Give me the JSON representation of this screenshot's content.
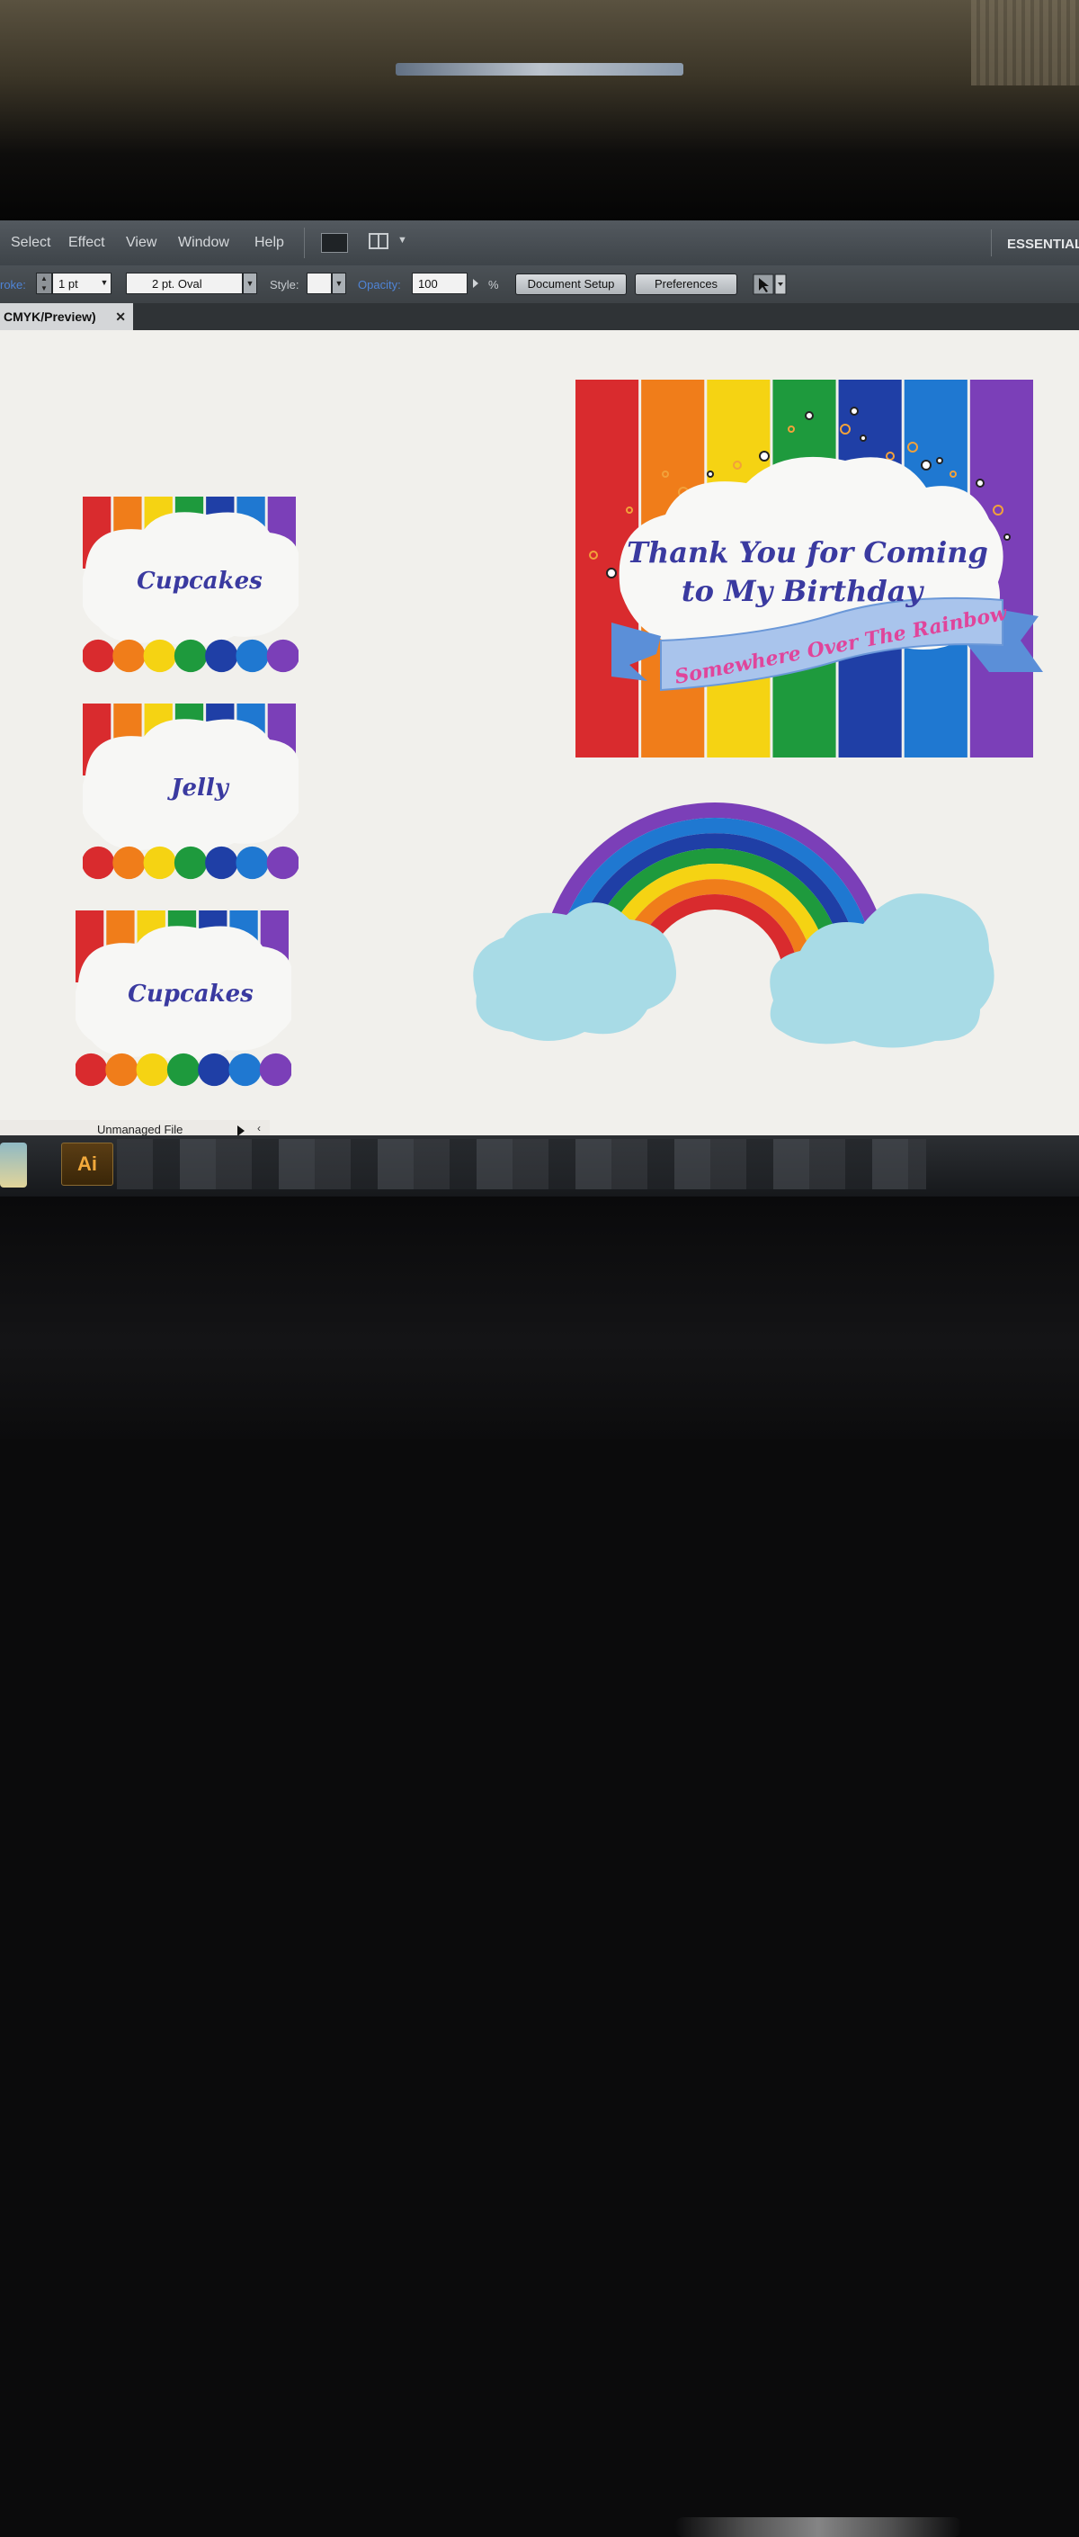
{
  "menubar": {
    "items": [
      "Select",
      "Effect",
      "View",
      "Window",
      "Help"
    ],
    "workspace": "ESSENTIAL"
  },
  "controlbar": {
    "stroke_label": "roke:",
    "stroke_weight": "1 pt",
    "brush": "2 pt. Oval",
    "style_label": "Style:",
    "opacity_label": "Opacity:",
    "opacity_value": "100",
    "percent": "%",
    "document_setup": "Document Setup",
    "preferences": "Preferences"
  },
  "document_tab": {
    "label": "CMYK/Preview)",
    "close": "✕"
  },
  "status": {
    "label": "Unmanaged File"
  },
  "taskbar": {
    "ai_label": "Ai"
  },
  "artwork": {
    "labels": [
      "Cupcakes",
      "Jelly",
      "Cupcakes"
    ],
    "card_title_line1": "Thank You for Coming",
    "card_title_line2": "to My Birthday",
    "ribbon_text": "Somewhere Over The Rainbow",
    "rainbow_colors": [
      "#d92b2e",
      "#f07d1a",
      "#f5d313",
      "#1e9a3d",
      "#1f3fa6",
      "#1f78d1",
      "#7b3fb8"
    ],
    "text_color": "#3a3aa0",
    "ribbon_text_color": "#e0459b"
  }
}
